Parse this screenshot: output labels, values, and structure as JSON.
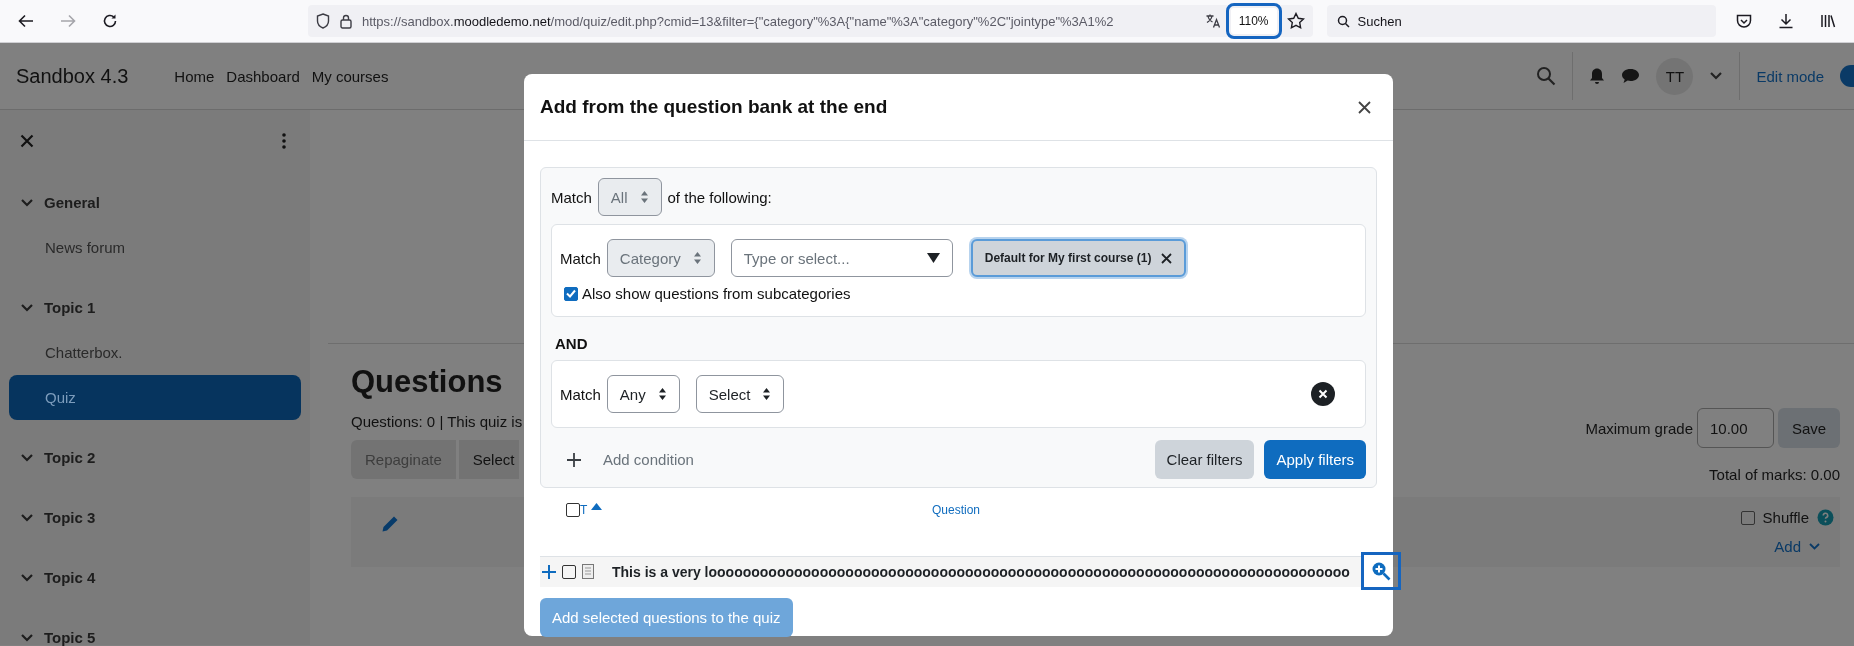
{
  "browser": {
    "url": {
      "prefix": "https://sandbox.",
      "host": "moodledemo.net",
      "path": "/mod/quiz/edit.php?cmid=13&filter={\"category\"%3A{\"name\"%3A\"category\"%2C\"jointype\"%3A1%2"
    },
    "zoom": {
      "label": "110%",
      "highlighted": true
    },
    "search_placeholder": "Suchen"
  },
  "site": {
    "brand": "Sandbox 4.3",
    "nav": [
      "Home",
      "Dashboard",
      "My courses"
    ],
    "avatar": "TT",
    "edit_mode": "Edit mode",
    "edit_mode_on": true
  },
  "sidebar": {
    "sections": [
      {
        "title": "General",
        "expanded": true,
        "children": [
          {
            "label": "News forum",
            "selected": false
          }
        ]
      },
      {
        "title": "Topic 1",
        "expanded": true,
        "children": [
          {
            "label": "Chatterbox.",
            "selected": false
          },
          {
            "label": "Quiz",
            "selected": true
          }
        ]
      },
      {
        "title": "Topic 2",
        "expanded": true
      },
      {
        "title": "Topic 3",
        "expanded": true
      },
      {
        "title": "Topic 4",
        "expanded": true
      },
      {
        "title": "Topic 5",
        "expanded": true
      }
    ]
  },
  "page": {
    "heading": "Questions",
    "summary": "Questions: 0 | This quiz is",
    "buttons": [
      {
        "label": "Repaginate",
        "disabled": true
      },
      {
        "label": "Select",
        "disabled": false
      }
    ],
    "max_grade_label": "Maximum grade",
    "max_grade": "10.00",
    "save": "Save",
    "total": "Total of marks: 0.00",
    "shuffle": {
      "label": "Shuffle",
      "checked": false
    },
    "add": "Add"
  },
  "dialog": {
    "title": "Add from the question bank at the end",
    "match_label": "Match",
    "match": {
      "value": "All",
      "disabled": true
    },
    "match_suffix": "of the following:",
    "conditions": [
      {
        "kind": "category",
        "match_label": "Match",
        "match": {
          "value": "Category",
          "disabled": true
        },
        "placeholder": "Type or select...",
        "chips": [
          "Default for My first course (1)"
        ],
        "option": {
          "label": "Also show questions from subcategories",
          "checked": true
        }
      },
      {
        "kind": "generic",
        "match_label": "Match",
        "match": {
          "value": "Any",
          "disabled": false
        },
        "type": {
          "value": "Select",
          "disabled": false
        }
      }
    ],
    "joiner": "AND",
    "add_condition": "Add condition",
    "clear": "Clear filters",
    "apply": "Apply filters",
    "table": {
      "select_all_checked": false,
      "columns": [
        {
          "label": "T",
          "sorted": true
        },
        {
          "label": "Question",
          "sorted": false
        }
      ],
      "rows": [
        {
          "checked": false,
          "text": "This is a very looooooooooooooooooooooooooooooooooooooooooooooooooooooooooooooooooooooooooo",
          "preview_highlighted": true
        }
      ]
    },
    "submit": {
      "label": "Add selected questions to the quiz",
      "disabled": true
    }
  }
}
